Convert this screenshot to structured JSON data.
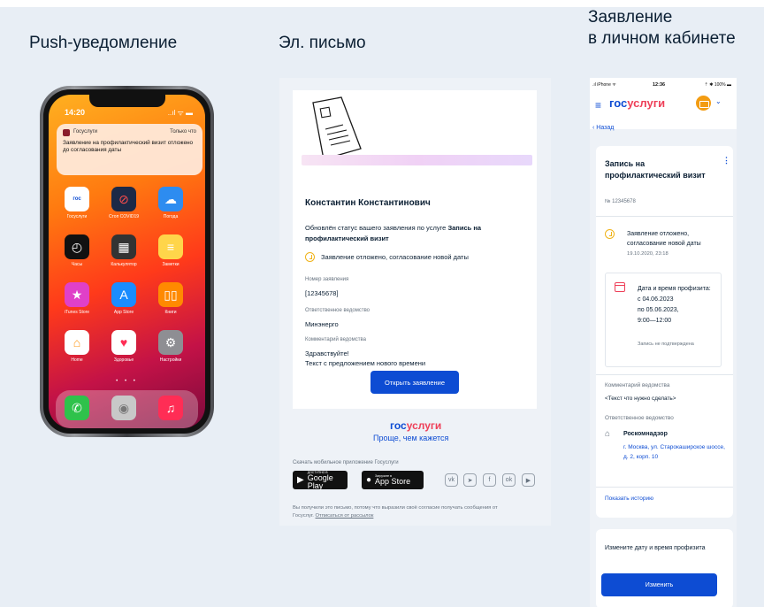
{
  "columns": {
    "push_title": "Push-уведомление",
    "email_title": "Эл. письмо",
    "cabinet_title_1": "Заявление",
    "cabinet_title_2": "в личном кабинете"
  },
  "phone": {
    "time": "14:20",
    "signal": "..ıl ᯤ ▬",
    "notification": {
      "app": "Госуслуги",
      "time": "Только что",
      "text": "Заявление на профилактический визит отложено до согласования даты"
    },
    "apps": [
      {
        "label": "Госуслуги",
        "icon": "gosuslugi-icon",
        "color": "#ffffff"
      },
      {
        "label": "Стоп COVID19",
        "icon": "stop-covid-icon",
        "color": "#1c2a47"
      },
      {
        "label": "Погода",
        "icon": "weather-icon",
        "color": "#2d8cf0"
      },
      {
        "label": "Часы",
        "icon": "clock-icon",
        "color": "#111111"
      },
      {
        "label": "Калькулятор",
        "icon": "calculator-icon",
        "color": "#333333"
      },
      {
        "label": "Заметки",
        "icon": "notes-icon",
        "color": "#ffd54a"
      },
      {
        "label": "iTunes Store",
        "icon": "star-icon",
        "color": "#e040c8"
      },
      {
        "label": "App Store",
        "icon": "app-store-icon",
        "color": "#1a8cff"
      },
      {
        "label": "Книги",
        "icon": "books-icon",
        "color": "#ff8a00"
      },
      {
        "label": "Home",
        "icon": "home-icon",
        "color": "#ff9a1a"
      },
      {
        "label": "Здоровье",
        "icon": "heart-icon",
        "color": "#ffffff"
      },
      {
        "label": "Настройки",
        "icon": "settings-icon",
        "color": "#8e8e93"
      }
    ],
    "dock": [
      {
        "icon": "phone-icon",
        "color": "#2fc24b"
      },
      {
        "icon": "contacts-icon",
        "color": "#c8c8c8"
      },
      {
        "icon": "music-icon",
        "color": "#ff2d55"
      }
    ]
  },
  "email": {
    "name": "Константин Константинович",
    "para_prefix": "Обновлён статус вашего заявления по услуге ",
    "para_service": "Запись на профилактический визит",
    "status": "Заявление отложено, согласование новой даты",
    "number_label": "Номер заявления",
    "number_value": "[12345678]",
    "dept_label": "Ответственное ведомство",
    "dept_value": "Минэнерго",
    "comment_label": "Комментарий ведомства",
    "comment_line1": "Здравствуйте!",
    "comment_line2": "Текст с предложением нового времени",
    "button": "Открыть заявление",
    "logo_a": "гос",
    "logo_b": "услуги",
    "slogan": "Проще, чем кажется",
    "download": "Скачать мобильное приложение Госуслуги",
    "google_small": "ДОСТУПНО В",
    "google_big": "Google Play",
    "apple_small": "Загрузите в",
    "apple_big": "App Store",
    "social": [
      "vk",
      "➤",
      "f",
      "ok",
      "▶"
    ],
    "footer": "Вы получили это письмо, потому что выразили своё согласие получать сообщения от Госуслуг.",
    "unsubscribe": "Отписаться от рассылок"
  },
  "cabinet": {
    "sb_left": ".ıl iPhone ᯤ",
    "sb_time": "12:36",
    "sb_right": "⇡ ✱ 100% ▬",
    "logo_a": "гос",
    "logo_b": "услуги",
    "back": "‹ Назад",
    "title": "Запись на профилактический визит",
    "number": "№ 12345678",
    "status": "Заявление отложено, согласование новой даты",
    "status_date": "19.10.2020, 23:18",
    "date_label": "Дата и время профизита:",
    "date_from": "с 04.06.2023",
    "date_to": "по 05.06.2023,",
    "date_time": "9:00—12:00",
    "date_note": "Запись не подтверждена",
    "comment_label": "Комментарий ведомства",
    "comment_value": "<Текст что нужно сделать>",
    "dept_label": "Ответственное ведомство",
    "dept_org": "Роскомнадзор",
    "dept_addr": "г. Москва, ул. Старокаширское шоссе, д. 2, корп. 10",
    "history": "Показать историю",
    "change_text": "Измените дату и время профизита",
    "change_button": "Изменить"
  },
  "colors": {
    "brand_blue": "#0d4cd3",
    "brand_red": "#ee3f58",
    "status_yellow": "#f0b319"
  }
}
